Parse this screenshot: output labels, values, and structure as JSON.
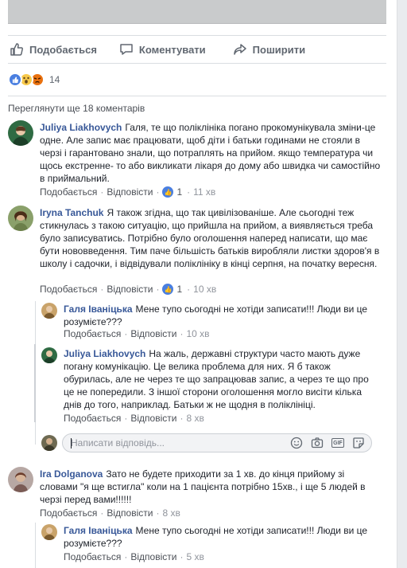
{
  "actions": {
    "like": "Подобається",
    "comment": "Коментувати",
    "share": "Поширити"
  },
  "reactions": {
    "count": "14"
  },
  "view_more": "Переглянути ще 18 коментарів",
  "comment_meta": {
    "like": "Подобається",
    "reply": "Відповісти"
  },
  "comments": [
    {
      "author": "Juliya Liakhovych",
      "text": "Галя, те що поліклініка погано прокомунікувала зміни-це одне. Але запис має працювати, щоб діти і батьки годинами не стояли в черзі і гарантовано знали, що потраплять на прийом. якщо температура чи щось екстренне- то або викликати лікаря до дому або швидка чи самостійно в приймальний.",
      "likes": "1",
      "time": "11 хв"
    },
    {
      "author": "Iryna Tanchuk",
      "text": "Я також згідна, що так цивілізованіше. Але сьогодні теж стикнулась з такою ситуацію, що прийшла на прийом, а виявляється треба було записуватись. Потрібно було оголошення наперед написати, що має бути нововведення. Тим паче більшість батьків виробляли листки здоров'я в школу і садочки, і відвідували поліклініку в кінці серпня, на початку вересня.",
      "likes": "1",
      "time": "10 хв"
    },
    {
      "author": "Ira Dolganova",
      "text": "Зато не будете приходити за 1 хв. до кінця прийому зі словами \"я ще встигла\" коли на 1 пацієнта потрібно 15хв., і ще 5 людей в черзі перед вами!!!!!!",
      "time": "8 хв"
    }
  ],
  "replies": [
    {
      "author": "Галя Іваніцька",
      "text": "Мене тупо сьогодні не хотіди записати!!! Люди ви це розумієте???",
      "time": "10 хв"
    },
    {
      "author": "Juliya Liakhovych",
      "text": "На жаль, державні структури часто мають дуже погану комунікацію. Це велика проблема для них. Я б також обурилась, але не через те що запрацював запис, а через те що про це не попередили. З іншої сторони оголошення могло висіти кілька днів до того, наприклад. Батьки ж не щодня в поліклініці.",
      "time": "8 хв"
    },
    {
      "author": "Галя Іваніцька",
      "text": "Мене тупо сьогодні не хотіди записати!!! Люди ви це розумієте???",
      "time": "5 хв"
    }
  ],
  "reply_box": {
    "placeholder": "Написати відповідь..."
  }
}
